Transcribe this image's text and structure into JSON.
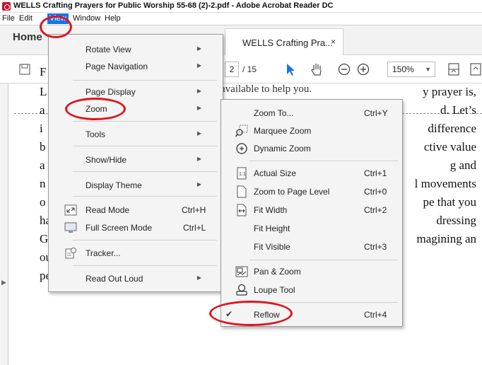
{
  "window": {
    "title": "WELLS Crafting Prayers for Public Worship 55-68 (2)-2.pdf - Adobe Acrobat Reader DC"
  },
  "menubar": {
    "file": "File",
    "edit": "Edit",
    "view": "View",
    "window": "Window",
    "help": "Help"
  },
  "tabs": {
    "home": "Home",
    "document": "WELLS Crafting Pra...",
    "close_glyph": "×"
  },
  "toolbar": {
    "page_current": "2",
    "page_total": "/ 15",
    "zoom": "150%"
  },
  "view_menu": {
    "items": [
      {
        "label": "Rotate View",
        "submenu": true
      },
      {
        "label": "Page Navigation",
        "submenu": true
      },
      {
        "label": "Page Display",
        "submenu": true
      },
      {
        "label": "Zoom",
        "submenu": true
      },
      {
        "label": "Tools",
        "submenu": true
      },
      {
        "label": "Show/Hide",
        "submenu": true
      },
      {
        "label": "Display Theme",
        "submenu": true
      },
      {
        "label": "Read Mode",
        "shortcut": "Ctrl+H"
      },
      {
        "label": "Full Screen Mode",
        "shortcut": "Ctrl+L"
      },
      {
        "label": "Tracker..."
      },
      {
        "label": "Read Out Loud",
        "submenu": true
      }
    ]
  },
  "zoom_menu": {
    "items": [
      {
        "label": "Zoom To...",
        "shortcut": "Ctrl+Y"
      },
      {
        "label": "Marquee Zoom"
      },
      {
        "label": "Dynamic Zoom"
      },
      {
        "label": "Actual Size",
        "shortcut": "Ctrl+1"
      },
      {
        "label": "Zoom to Page Level",
        "shortcut": "Ctrl+0"
      },
      {
        "label": "Fit Width",
        "shortcut": "Ctrl+2"
      },
      {
        "label": "Fit Height"
      },
      {
        "label": "Fit Visible",
        "shortcut": "Ctrl+3"
      },
      {
        "label": "Pan & Zoom"
      },
      {
        "label": "Loupe Tool"
      },
      {
        "label": "Reflow",
        "shortcut": "Ctrl+4",
        "checked": true
      }
    ]
  },
  "document": {
    "top_fragment": "available to help you.",
    "lines": [
      {
        "left": "F",
        "right": ""
      },
      {
        "left": "L",
        "right": "y prayer is,"
      },
      {
        "left": "a",
        "right": "d. Let’s"
      },
      {
        "left": "i",
        "right": "difference"
      },
      {
        "left": "b",
        "right": "ctive value"
      },
      {
        "left": "a",
        "right": "g and"
      },
      {
        "left": "n",
        "right": "l movements"
      },
      {
        "left": "o",
        "right": "pe that you"
      },
      {
        "left": "have a grasp of the form of a ",
        "right": "dressing"
      },
      {
        "left": "God, invoking a scriptural pr",
        "right": "magining an"
      },
      {
        "full": "outcome, and concluding. Let’s take it that you’ve gained a reasonable"
      },
      {
        "full": "perception of the scriptures assigned for the day and the matters in the"
      }
    ]
  },
  "colors": {
    "menu_bg": "#f4f4f4",
    "highlight": "#1a73e8",
    "annotation": "#e0141e",
    "pdf_red": "#c8102e"
  }
}
